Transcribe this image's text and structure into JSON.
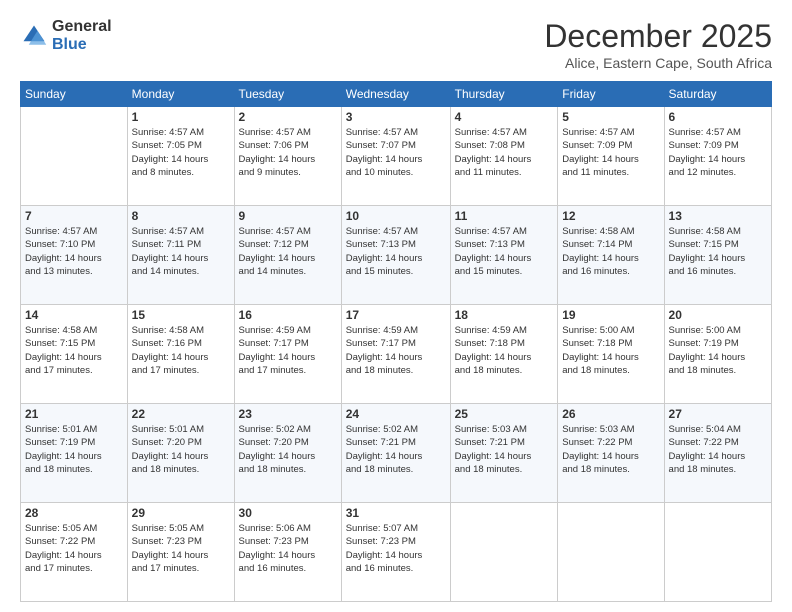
{
  "logo": {
    "general": "General",
    "blue": "Blue"
  },
  "title": "December 2025",
  "subtitle": "Alice, Eastern Cape, South Africa",
  "days_header": [
    "Sunday",
    "Monday",
    "Tuesday",
    "Wednesday",
    "Thursday",
    "Friday",
    "Saturday"
  ],
  "weeks": [
    [
      {
        "day": "",
        "info": ""
      },
      {
        "day": "1",
        "info": "Sunrise: 4:57 AM\nSunset: 7:05 PM\nDaylight: 14 hours\nand 8 minutes."
      },
      {
        "day": "2",
        "info": "Sunrise: 4:57 AM\nSunset: 7:06 PM\nDaylight: 14 hours\nand 9 minutes."
      },
      {
        "day": "3",
        "info": "Sunrise: 4:57 AM\nSunset: 7:07 PM\nDaylight: 14 hours\nand 10 minutes."
      },
      {
        "day": "4",
        "info": "Sunrise: 4:57 AM\nSunset: 7:08 PM\nDaylight: 14 hours\nand 11 minutes."
      },
      {
        "day": "5",
        "info": "Sunrise: 4:57 AM\nSunset: 7:09 PM\nDaylight: 14 hours\nand 11 minutes."
      },
      {
        "day": "6",
        "info": "Sunrise: 4:57 AM\nSunset: 7:09 PM\nDaylight: 14 hours\nand 12 minutes."
      }
    ],
    [
      {
        "day": "7",
        "info": "Sunrise: 4:57 AM\nSunset: 7:10 PM\nDaylight: 14 hours\nand 13 minutes."
      },
      {
        "day": "8",
        "info": "Sunrise: 4:57 AM\nSunset: 7:11 PM\nDaylight: 14 hours\nand 14 minutes."
      },
      {
        "day": "9",
        "info": "Sunrise: 4:57 AM\nSunset: 7:12 PM\nDaylight: 14 hours\nand 14 minutes."
      },
      {
        "day": "10",
        "info": "Sunrise: 4:57 AM\nSunset: 7:13 PM\nDaylight: 14 hours\nand 15 minutes."
      },
      {
        "day": "11",
        "info": "Sunrise: 4:57 AM\nSunset: 7:13 PM\nDaylight: 14 hours\nand 15 minutes."
      },
      {
        "day": "12",
        "info": "Sunrise: 4:58 AM\nSunset: 7:14 PM\nDaylight: 14 hours\nand 16 minutes."
      },
      {
        "day": "13",
        "info": "Sunrise: 4:58 AM\nSunset: 7:15 PM\nDaylight: 14 hours\nand 16 minutes."
      }
    ],
    [
      {
        "day": "14",
        "info": "Sunrise: 4:58 AM\nSunset: 7:15 PM\nDaylight: 14 hours\nand 17 minutes."
      },
      {
        "day": "15",
        "info": "Sunrise: 4:58 AM\nSunset: 7:16 PM\nDaylight: 14 hours\nand 17 minutes."
      },
      {
        "day": "16",
        "info": "Sunrise: 4:59 AM\nSunset: 7:17 PM\nDaylight: 14 hours\nand 17 minutes."
      },
      {
        "day": "17",
        "info": "Sunrise: 4:59 AM\nSunset: 7:17 PM\nDaylight: 14 hours\nand 18 minutes."
      },
      {
        "day": "18",
        "info": "Sunrise: 4:59 AM\nSunset: 7:18 PM\nDaylight: 14 hours\nand 18 minutes."
      },
      {
        "day": "19",
        "info": "Sunrise: 5:00 AM\nSunset: 7:18 PM\nDaylight: 14 hours\nand 18 minutes."
      },
      {
        "day": "20",
        "info": "Sunrise: 5:00 AM\nSunset: 7:19 PM\nDaylight: 14 hours\nand 18 minutes."
      }
    ],
    [
      {
        "day": "21",
        "info": "Sunrise: 5:01 AM\nSunset: 7:19 PM\nDaylight: 14 hours\nand 18 minutes."
      },
      {
        "day": "22",
        "info": "Sunrise: 5:01 AM\nSunset: 7:20 PM\nDaylight: 14 hours\nand 18 minutes."
      },
      {
        "day": "23",
        "info": "Sunrise: 5:02 AM\nSunset: 7:20 PM\nDaylight: 14 hours\nand 18 minutes."
      },
      {
        "day": "24",
        "info": "Sunrise: 5:02 AM\nSunset: 7:21 PM\nDaylight: 14 hours\nand 18 minutes."
      },
      {
        "day": "25",
        "info": "Sunrise: 5:03 AM\nSunset: 7:21 PM\nDaylight: 14 hours\nand 18 minutes."
      },
      {
        "day": "26",
        "info": "Sunrise: 5:03 AM\nSunset: 7:22 PM\nDaylight: 14 hours\nand 18 minutes."
      },
      {
        "day": "27",
        "info": "Sunrise: 5:04 AM\nSunset: 7:22 PM\nDaylight: 14 hours\nand 18 minutes."
      }
    ],
    [
      {
        "day": "28",
        "info": "Sunrise: 5:05 AM\nSunset: 7:22 PM\nDaylight: 14 hours\nand 17 minutes."
      },
      {
        "day": "29",
        "info": "Sunrise: 5:05 AM\nSunset: 7:23 PM\nDaylight: 14 hours\nand 17 minutes."
      },
      {
        "day": "30",
        "info": "Sunrise: 5:06 AM\nSunset: 7:23 PM\nDaylight: 14 hours\nand 16 minutes."
      },
      {
        "day": "31",
        "info": "Sunrise: 5:07 AM\nSunset: 7:23 PM\nDaylight: 14 hours\nand 16 minutes."
      },
      {
        "day": "",
        "info": ""
      },
      {
        "day": "",
        "info": ""
      },
      {
        "day": "",
        "info": ""
      }
    ]
  ]
}
